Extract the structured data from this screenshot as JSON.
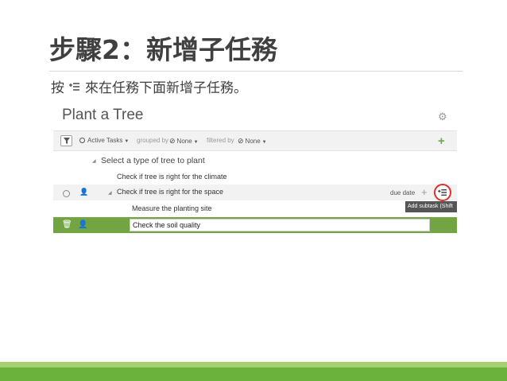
{
  "slide": {
    "title": "步驟2：新增子任務",
    "bullet_prefix": "按",
    "bullet_suffix": "來在任務下面新增子任務。"
  },
  "app": {
    "project_title": "Plant a Tree",
    "toolbar": {
      "active_tasks": "Active Tasks",
      "grouped_by_label": "grouped by",
      "grouped_by_value": "None",
      "filtered_by_label": "filtered by",
      "filtered_by_value": "None"
    },
    "section": {
      "title": "Select a type of tree to plant"
    },
    "tasks": [
      {
        "title": "Check if tree is right for the climate"
      },
      {
        "title": "Check if tree is right for the space",
        "due_label": "due date"
      }
    ],
    "subtasks": [
      {
        "title": "Measure the planting site"
      }
    ],
    "tooltip": "Add subtask (Shift",
    "edit_value": "Check the soil quality"
  },
  "colors": {
    "accent_green": "#72a542",
    "highlight_red": "#e0302a",
    "footer_light": "#a5d06d",
    "footer_dark": "#6ab23b"
  },
  "icons": [
    "gear-icon",
    "filter-icon",
    "circle-icon",
    "none-icon",
    "plus-icon",
    "person-icon",
    "add-subtask-icon",
    "trash-icon"
  ]
}
